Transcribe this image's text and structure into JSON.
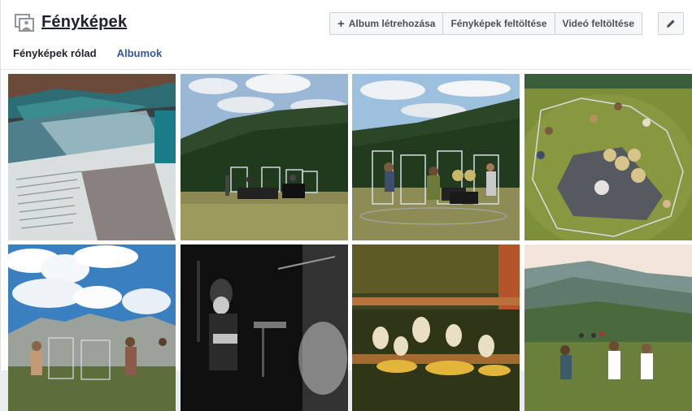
{
  "header": {
    "title": "Fényképek",
    "buttons": {
      "create_album": "Album létrehozása",
      "upload_photos": "Fényképek feltöltése",
      "upload_video": "Videó feltöltése"
    }
  },
  "tabs": [
    {
      "label": "Fényképek rólad"
    },
    {
      "label": "Albumok"
    }
  ],
  "colors": {
    "link": "#365899",
    "text": "#1d2129",
    "button_bg": "#f6f7f9",
    "border": "#ccd0d5"
  },
  "icons": {
    "title_icon": "photos-icon",
    "plus_icon": "plus-icon",
    "edit_icon": "pencil-icon"
  }
}
